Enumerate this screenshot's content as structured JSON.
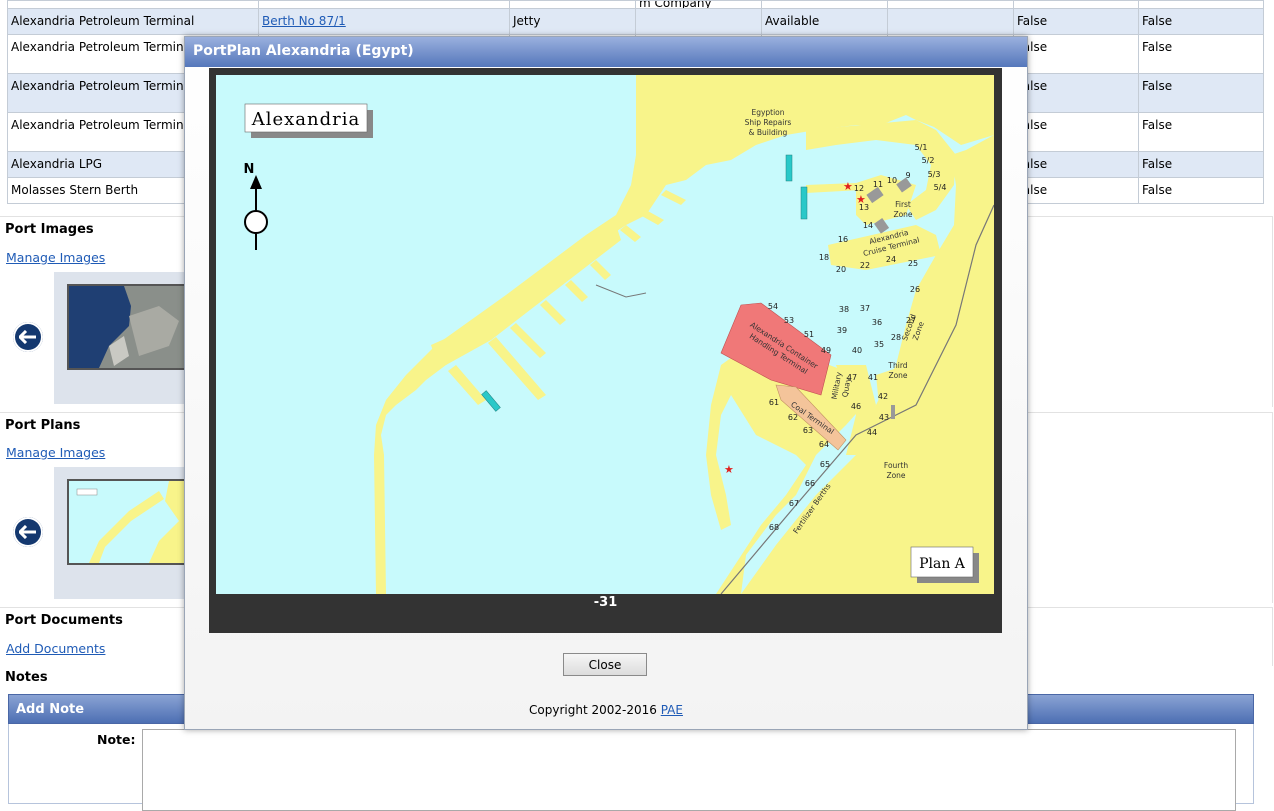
{
  "table": {
    "top_fragment": "m Company",
    "rows": [
      {
        "terminal": "Alexandria Petroleum Terminal",
        "berth": "Berth No 87/1",
        "type": "Jetty",
        "status": "Available",
        "col_a": "False",
        "col_b": "False"
      },
      {
        "terminal": "Alexandria Petroleum Terminal",
        "col_a": "False",
        "col_b": "False"
      },
      {
        "terminal": "Alexandria Petroleum Terminal",
        "col_a": "False",
        "col_b": "False"
      },
      {
        "terminal": "Alexandria Petroleum Terminal",
        "col_a": "False",
        "col_b": "False"
      },
      {
        "terminal": "Alexandria LPG",
        "col_a": "False",
        "col_b": "False"
      },
      {
        "terminal": "Molasses Stern Berth",
        "col_a": "False",
        "col_b": "False"
      }
    ]
  },
  "sections": {
    "port_images": {
      "title": "Port Images",
      "link": "Manage Images"
    },
    "port_plans": {
      "title": "Port Plans",
      "link": "Manage Images"
    },
    "port_documents": {
      "title": "Port Documents",
      "link": "Add Documents"
    },
    "notes": {
      "title": "Notes",
      "add_note": "Add Note",
      "note_label": "Note:"
    }
  },
  "modal": {
    "title": "PortPlan Alexandria (Egypt)",
    "caption": "-31",
    "close_label": "Close",
    "copyright_text": "Copyright 2002-2016",
    "copyright_link": "PAE",
    "map": {
      "city_label": "Alexandria",
      "plan_label": "Plan A",
      "north_label": "N",
      "labels": {
        "ship_repairs_1": "Egyption",
        "ship_repairs_2": "Ship Repairs",
        "ship_repairs_3": "& Building",
        "first_zone_1": "First",
        "first_zone_2": "Zone",
        "cruise_1": "Alexandria",
        "cruise_2": "Cruise Terminal",
        "container_1": "Alexandria Container",
        "container_2": "Handling Terminal",
        "military_1": "Military",
        "military_2": "Quay",
        "second_zone_1": "Second",
        "second_zone_2": "Zone",
        "third_zone_1": "Third",
        "third_zone_2": "Zone",
        "coal": "Coal Terminal",
        "fourth_zone_1": "Fourth",
        "fourth_zone_2": "Zone",
        "fertilizer": "Fertilizer Berths"
      },
      "berths": {
        "b5_1": "5/1",
        "b5_2": "5/2",
        "b5_3": "5/3",
        "b5_4": "5/4",
        "b9": "9",
        "b10": "10",
        "b11": "11",
        "b12": "12",
        "b13": "13",
        "b14": "14",
        "b16": "16",
        "b18": "18",
        "b20": "20",
        "b22": "22",
        "b24": "24",
        "b25": "25",
        "b26": "26",
        "b27": "27",
        "b28": "28",
        "b35": "35",
        "b36": "36",
        "b37": "37",
        "b38": "38",
        "b39": "39",
        "b40": "40",
        "b41": "41",
        "b42": "42",
        "b43": "43",
        "b44": "44",
        "b46": "46",
        "b47": "47",
        "b49": "49",
        "b51": "51",
        "b53": "53",
        "b54": "54",
        "b61": "61",
        "b62": "62",
        "b63": "63",
        "b64": "64",
        "b65": "65",
        "b66": "66",
        "b67": "67",
        "b68": "68"
      }
    }
  },
  "colors": {
    "water": "#c8fafc",
    "land": "#f8f48a",
    "container_terminal": "#f07878",
    "coal_terminal": "#f4c49a",
    "header_blue": "#5577bb",
    "arrow_button": "#14386f"
  }
}
